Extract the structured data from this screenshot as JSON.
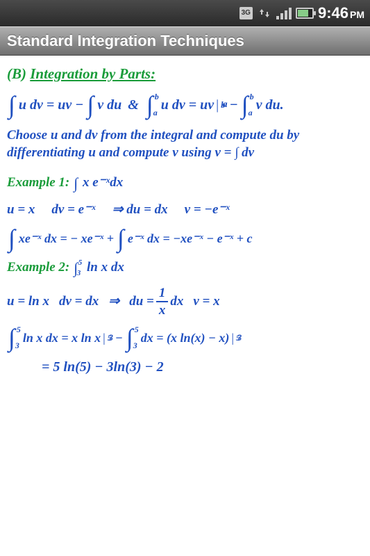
{
  "status": {
    "network": "3G",
    "time": "9:46",
    "ampm": "PM"
  },
  "titlebar": "Standard Integration Techniques",
  "section": {
    "prefix": "(B)",
    "title": "Integration by Parts:"
  },
  "formula": {
    "main": "u dv = uv −",
    "part2": "v du",
    "amp": "&",
    "def1": "u dv = uv",
    "eval": "|",
    "def2": "−",
    "def3": "v du."
  },
  "instruction": "Choose u and dv from the integral and compute du by differentiating u and compute v using   v = ∫ dv",
  "ex1": {
    "label": "Example 1:",
    "expr": "x e⁻ˣdx",
    "u": "u = x",
    "dv": "dv = e⁻ˣ",
    "arrow": "⇒ du = dx",
    "v": "v = −e⁻ˣ",
    "work1": "xe⁻ˣ dx = − xe⁻ˣ +",
    "work2": "e⁻ˣ dx = −xe⁻ˣ − e⁻ˣ + c"
  },
  "ex2": {
    "label": "Example 2:",
    "expr": "ln x  dx",
    "u": "u = ln x",
    "dv": "dv = dx",
    "arrow": "⇒",
    "du": "du =",
    "frac_num": "1",
    "frac_den": "x",
    "du2": "dx",
    "v": "v = x",
    "work1": "ln x dx = x ln x",
    "work1b": "−",
    "work2": "dx = (x ln(x) − x)",
    "result": "= 5 ln(5) − 3ln(3) − 2"
  },
  "limits": {
    "a": "a",
    "b": "b",
    "three": "3",
    "five": "5"
  }
}
